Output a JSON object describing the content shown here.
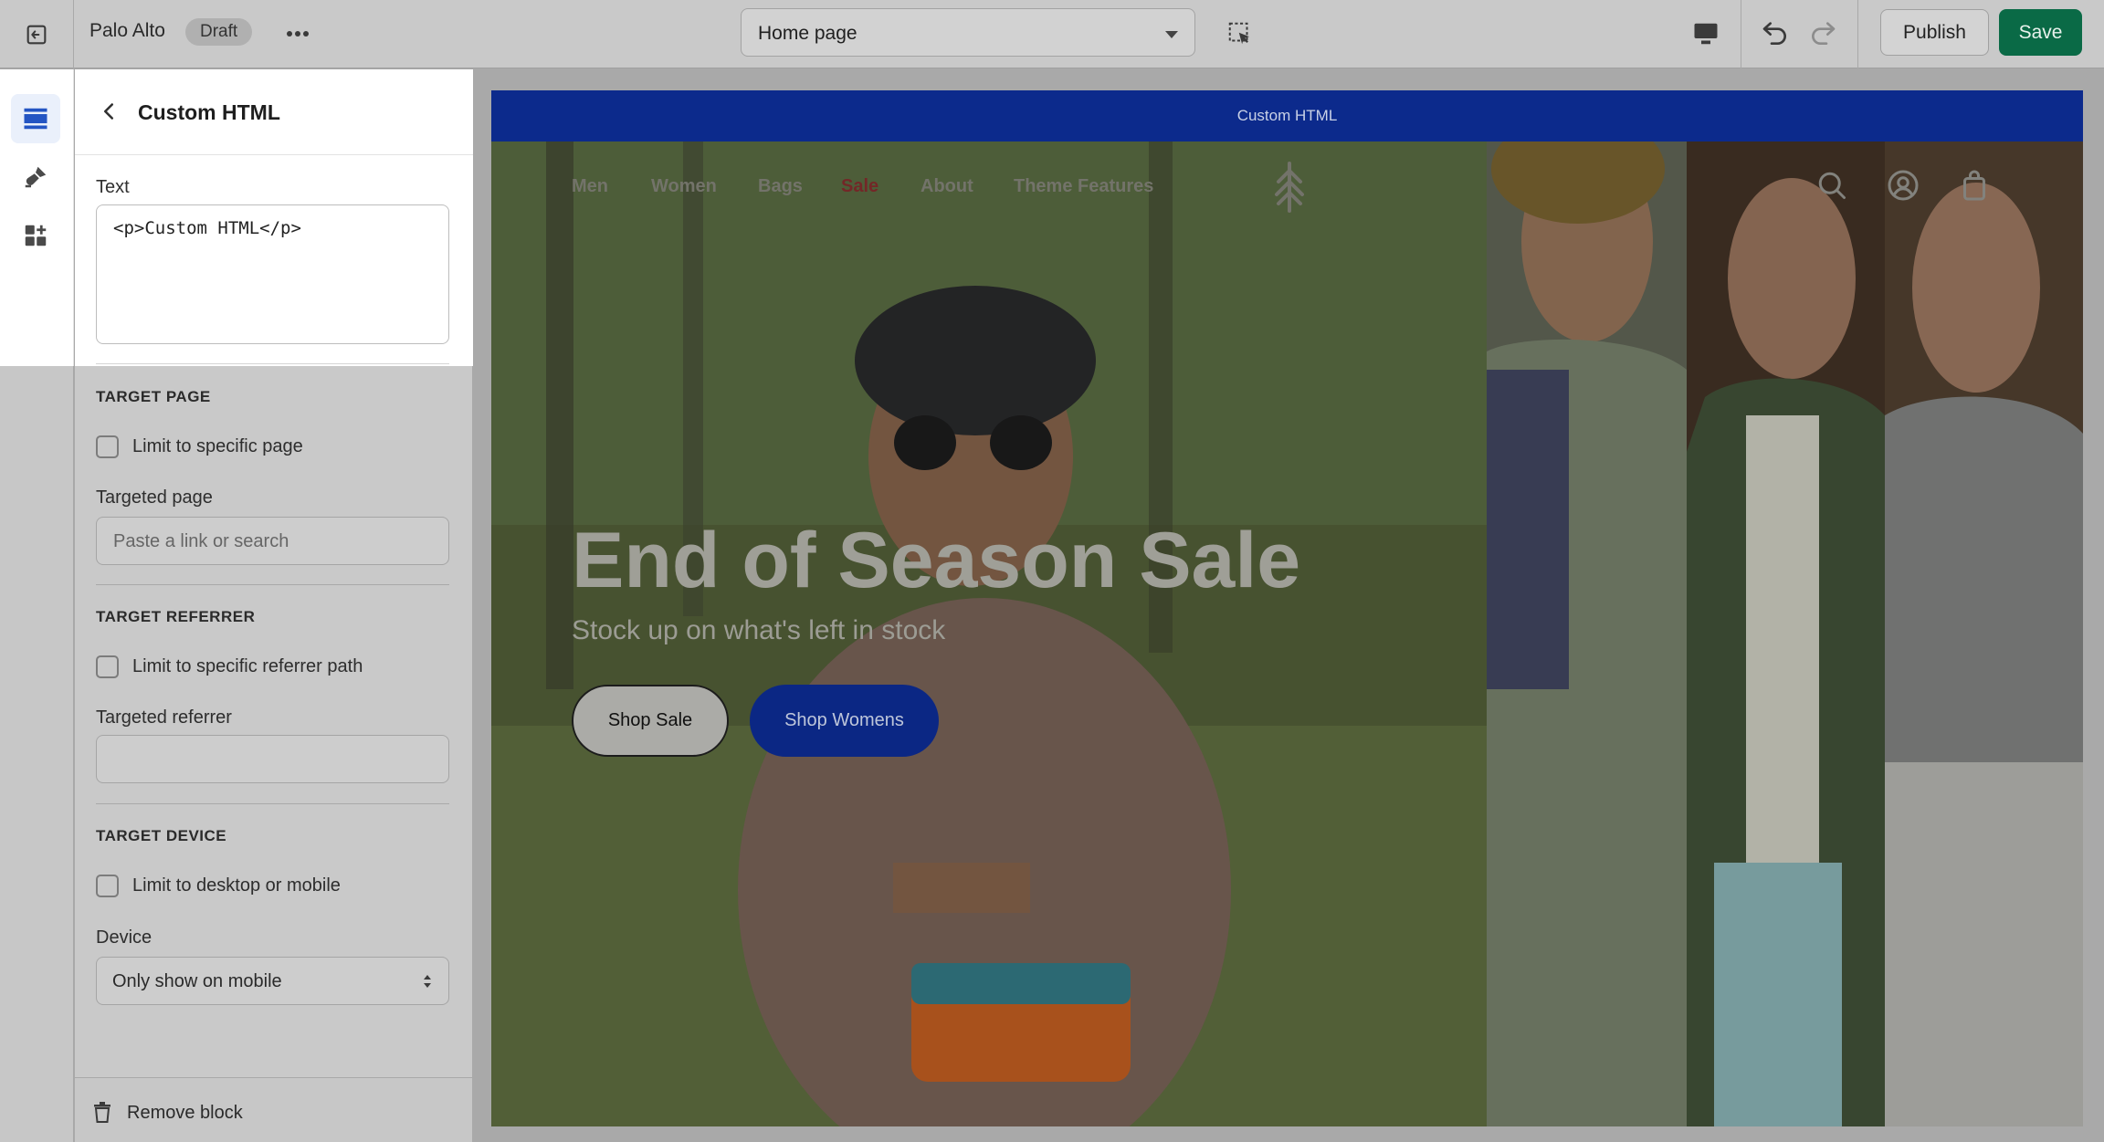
{
  "topbar": {
    "store_name": "Palo Alto",
    "status_badge": "Draft",
    "page_selector": "Home page",
    "publish_label": "Publish",
    "save_label": "Save"
  },
  "panel": {
    "title": "Custom HTML",
    "text_label": "Text",
    "text_value": "<p>Custom HTML</p>",
    "target_page": {
      "section_title": "TARGET PAGE",
      "checkbox_label": "Limit to specific page",
      "field_label": "Targeted page",
      "placeholder": "Paste a link or search"
    },
    "target_referrer": {
      "section_title": "TARGET REFERRER",
      "checkbox_label": "Limit to specific referrer path",
      "field_label": "Targeted referrer"
    },
    "target_device": {
      "section_title": "TARGET DEVICE",
      "checkbox_label": "Limit to desktop or mobile",
      "field_label": "Device",
      "selected": "Only show on mobile"
    },
    "remove_label": "Remove block"
  },
  "storefront": {
    "announcement": "Custom HTML",
    "nav": [
      "Men",
      "Women",
      "Bags",
      "Sale",
      "About",
      "Theme Features"
    ],
    "headline": "End of Season Sale",
    "subhead": "Stock up on what's left in stock",
    "btn_shop_sale": "Shop Sale",
    "btn_shop_womens": "Shop Womens"
  },
  "colors": {
    "save_green": "#0a6a46",
    "brand_blue": "#0c2a8c",
    "sale_red": "#7a2a2a"
  }
}
